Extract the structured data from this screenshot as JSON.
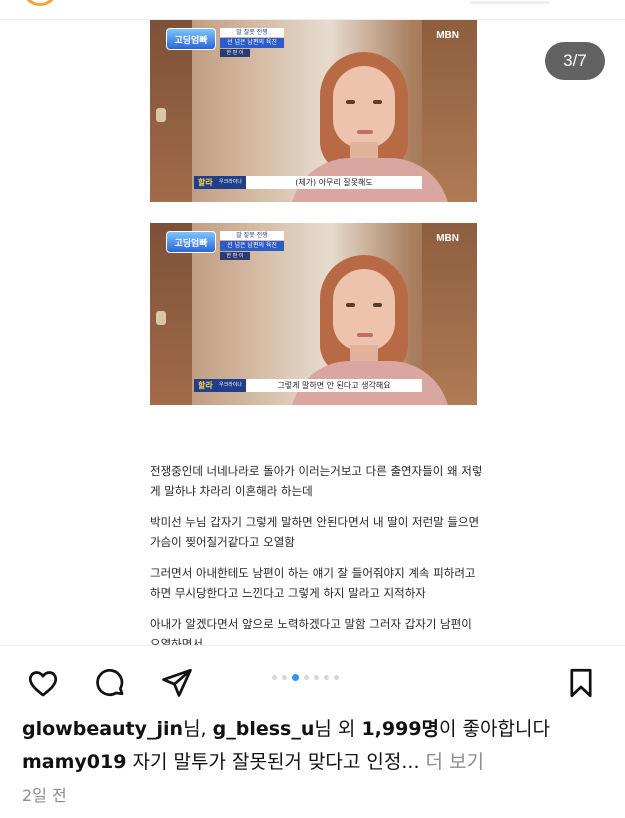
{
  "carousel": {
    "counter": "3/7",
    "dot_count": 7,
    "active_dot": 2
  },
  "frames": [
    {
      "channel": "MBN",
      "show_logo": "고딩엄빠",
      "show_caption_1": "말 잘못 전쟁",
      "show_caption_2": "선 넘은 남편의 육진",
      "show_caption_3": "한 판 이",
      "speaker_name": "할라",
      "speaker_sub": "우크라이나",
      "subtitle": "(제가) 아무리 잘못해도"
    },
    {
      "channel": "MBN",
      "show_logo": "고딩엄빠",
      "show_caption_1": "말 잘못 전쟁",
      "show_caption_2": "선 넘은 남편의 육진",
      "show_caption_3": "한 판 이",
      "speaker_name": "할라",
      "speaker_sub": "우크라이나",
      "subtitle": "그렇게 말하면 안 된다고 생각해요"
    }
  ],
  "post_text": {
    "p1": "전쟁중인데 너네나라로 돌아가 이러는거보고 다른 출연자들이 왜 저렇게 말하냐 차라리 이혼해라 하는데",
    "p2": "박미선 누님 갑자기 그렇게 말하면 안된다면서  내 딸이 저런말 들으면 가슴이 찢어질거같다고 오열함",
    "p3": "그러면서 아내한테도 남편이 하는 얘기 잘 들어줘야지 계속 피하려고 하면 무시당한다고 느낀다고 그렇게 하지 말라고 지적하자",
    "p4": "아내가 알겠다면서 앞으로 노력하겠다고 말함 그러자 갑자기 남편이 오열하면서"
  },
  "actions": {
    "like_icon": "heart-outline-icon",
    "comment_icon": "comment-bubble-icon",
    "share_icon": "paper-plane-icon",
    "save_icon": "bookmark-icon"
  },
  "likes": {
    "user1": "glowbeauty_jin",
    "sep1": "님, ",
    "user2": "g_bless_u",
    "mid": "님 외 ",
    "count": "1,999명",
    "tail": "이 좋아합니다"
  },
  "caption": {
    "username": "mamy019",
    "text": " 자기 말투가 잘못된거 맞다고 인정...",
    "more": " 더 보기"
  },
  "timestamp": "2일 전"
}
